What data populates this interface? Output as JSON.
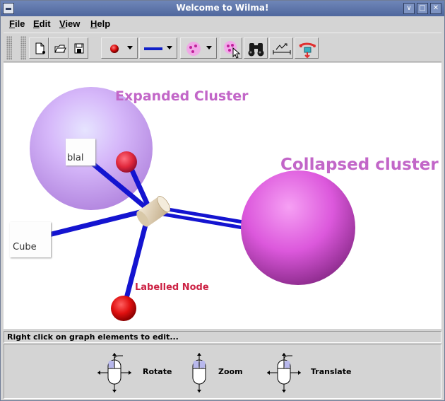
{
  "window": {
    "title": "Welcome to Wilma!",
    "buttons": [
      "∨",
      "□",
      "✕"
    ]
  },
  "menubar": {
    "items": [
      {
        "label": "File",
        "mnemonic": "F"
      },
      {
        "label": "Edit",
        "mnemonic": "E"
      },
      {
        "label": "View",
        "mnemonic": "V"
      },
      {
        "label": "Help",
        "mnemonic": "H"
      }
    ]
  },
  "toolbar": {
    "buttons": [
      {
        "name": "new-graph-icon"
      },
      {
        "name": "open-folder-icon"
      },
      {
        "name": "save-disk-icon"
      },
      {
        "name": "node-style-dropdown",
        "icon": "red-sphere-icon",
        "color": "#d81010"
      },
      {
        "name": "edge-style-dropdown",
        "icon": "blue-line-icon",
        "color": "#1020c8"
      },
      {
        "name": "cluster-style-dropdown",
        "icon": "pink-cluster-icon",
        "color": "#e070c8"
      },
      {
        "name": "select-cluster-icon"
      },
      {
        "name": "binoculars-icon"
      },
      {
        "name": "layout-icon"
      },
      {
        "name": "relax-layout-icon"
      }
    ]
  },
  "canvas": {
    "labels": {
      "expanded_cluster": "Expanded Cluster",
      "collapsed_cluster": "Collapsed cluster",
      "labelled_node": "Labelled Node",
      "blah_box": "blal",
      "cube_box": "Cube"
    },
    "colors": {
      "edge": "#1414d0",
      "node": "#e01414",
      "cluster_label": "#c266c8",
      "node_label": "#cc2244",
      "expanded_cluster": "#d8b8f8",
      "collapsed_cluster": "#e26ae2"
    }
  },
  "status": {
    "text": "Right click on graph elements to edit..."
  },
  "controls": {
    "items": [
      {
        "label": "Rotate"
      },
      {
        "label": "Zoom"
      },
      {
        "label": "Translate"
      }
    ]
  }
}
